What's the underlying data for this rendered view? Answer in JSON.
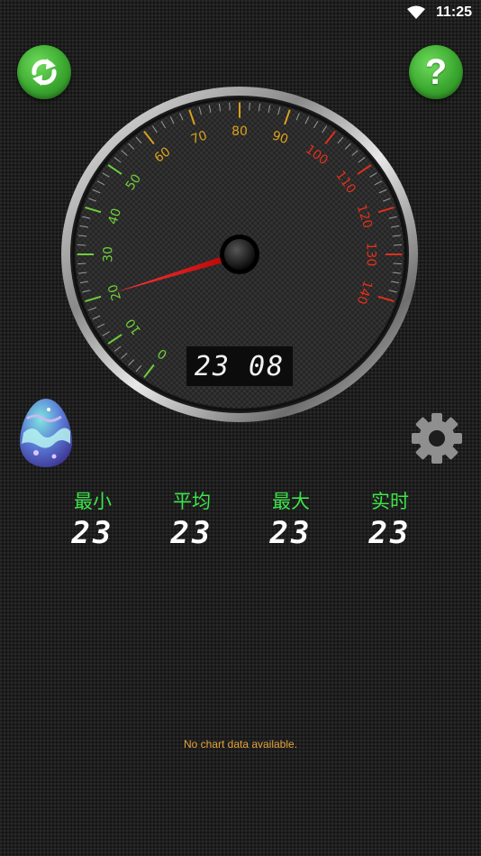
{
  "status_bar": {
    "time": "11:25",
    "wifi_icon": "wifi-icon"
  },
  "toolbar": {
    "refresh_icon": "refresh-arrows-icon",
    "help_label": "?",
    "accent": "#3aa72f"
  },
  "gauge": {
    "ticks": [
      "0",
      "10",
      "20",
      "30",
      "40",
      "50",
      "60",
      "70",
      "80",
      "90",
      "100",
      "110",
      "120",
      "130",
      "140"
    ],
    "needle_value": 20,
    "max_value": 140,
    "readout": "23 08"
  },
  "side_controls": {
    "egg_icon": "easter-egg-icon",
    "settings_icon": "gear-icon"
  },
  "stats": [
    {
      "label": "最小",
      "value": "23"
    },
    {
      "label": "平均",
      "value": "23"
    },
    {
      "label": "最大",
      "value": "23"
    },
    {
      "label": "实时",
      "value": "23"
    }
  ],
  "chart": {
    "empty_message": "No chart data available."
  }
}
